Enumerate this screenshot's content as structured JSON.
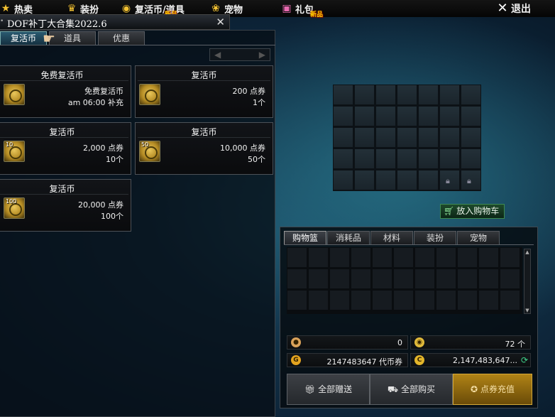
{
  "topnav": {
    "hot": {
      "label": "热卖",
      "icon": "star-icon"
    },
    "dress": {
      "label": "装扮",
      "icon": "trophy-icon"
    },
    "coins": {
      "label": "复活币/道具",
      "icon": "coin-icon",
      "badge": "新品"
    },
    "pet": {
      "label": "宠物",
      "icon": "paw-icon"
    },
    "gift": {
      "label": "礼包",
      "icon": "gift-icon",
      "badge": "新品"
    },
    "exit": {
      "label": "退出",
      "icon": "close-icon"
    }
  },
  "window": {
    "title": "DOF补丁大合集2022.6",
    "close": "✕"
  },
  "tabs": [
    "复活币",
    "道具",
    "优惠"
  ],
  "pager": {
    "prev": "◀",
    "next": "▶"
  },
  "items": [
    {
      "title": "免费复活币",
      "line1": "免费复活币",
      "line2": "am 06:00 补充",
      "badge": ""
    },
    {
      "title": "复活币",
      "line1": "200 点券",
      "line2": "1个",
      "badge": ""
    },
    {
      "title": "复活币",
      "line1": "2,000 点券",
      "line2": "10个",
      "badge": "10"
    },
    {
      "title": "复活币",
      "line1": "10,000 点券",
      "line2": "50个",
      "badge": "50"
    },
    {
      "title": "复活币",
      "line1": "20,000 点券",
      "line2": "100个",
      "badge": "100"
    }
  ],
  "add_to_cart": "放入购物车",
  "shop_tabs": [
    "购物篮",
    "消耗品",
    "材料",
    "装扮",
    "宠物"
  ],
  "scroll": {
    "up": "▲",
    "down": "▼"
  },
  "stats": {
    "cookie": "0",
    "coin_count": "72 个",
    "voucher": "2147483647 代币券",
    "points": "2,147,483,647..."
  },
  "buttons": {
    "gift_all": "全部赠送",
    "buy_all": "全部购买",
    "recharge": "点券充值"
  },
  "colors": {
    "gold": "#d4a838",
    "accent": "#3f8a52",
    "panel": "#0a0b0d"
  }
}
